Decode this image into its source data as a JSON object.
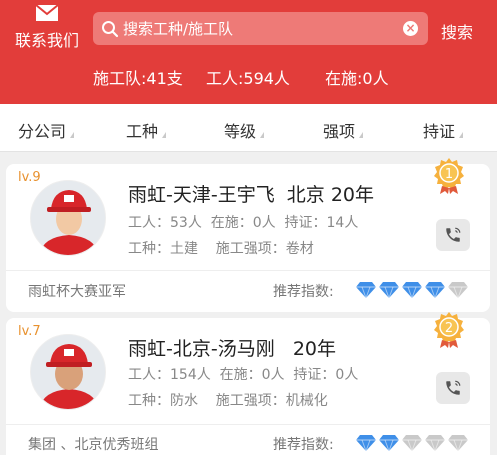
{
  "header": {
    "contact_label": "联系我们",
    "search_placeholder": "搜索工种/施工队",
    "search_button": "搜索",
    "stats": {
      "teams": "施工队:41支",
      "workers": "工人:594人",
      "active": "在施:0人"
    }
  },
  "filters": [
    {
      "label": "分公司"
    },
    {
      "label": "工种"
    },
    {
      "label": "等级"
    },
    {
      "label": "强项"
    },
    {
      "label": "持证"
    }
  ],
  "teams": [
    {
      "level": "lv.9",
      "name": "雨虹-天津-王宇飞  北京 20年",
      "stats_line": "工人：53人  在施：0人  持证：14人",
      "skill_line": "工种：土建    施工强项：卷材",
      "honor": "雨虹杯大赛亚军",
      "recommend_label": "推荐指数:",
      "rating_fraction": 0.8,
      "medal_rank": "1"
    },
    {
      "level": "lv.7",
      "name": "雨虹-北京-汤马刚   20年",
      "stats_line": "工人：154人  在施：0人  持证：0人",
      "skill_line": "工种：防水    施工强项：机械化",
      "honor": "集团 、北京优秀班组",
      "recommend_label": "推荐指数:",
      "rating_fraction": 0.4,
      "medal_rank": "2"
    }
  ],
  "colors": {
    "brand": "#e23d3a",
    "diamond_on": "#3f8fe8",
    "diamond_off": "#c9c9c9",
    "medal": "#f2a33a"
  }
}
